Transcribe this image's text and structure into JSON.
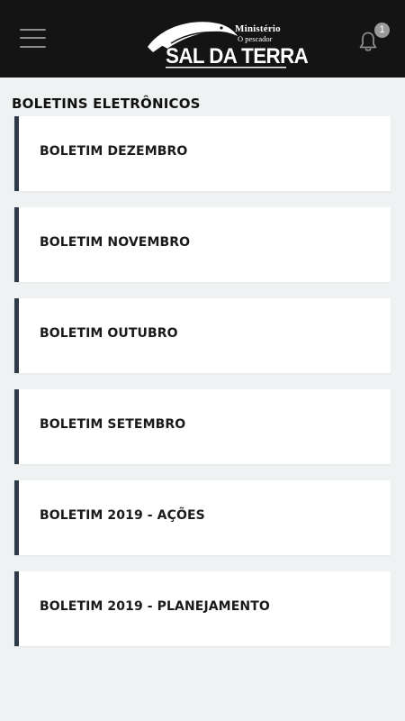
{
  "header": {
    "menu_icon": "hamburger-menu-icon",
    "logo": {
      "line1": "Ministério",
      "line2": "O pescador",
      "brand": "SAL DA TERRA"
    },
    "notifications": {
      "icon": "bell-icon",
      "count": "1"
    }
  },
  "section": {
    "title": "BOLETINS ELETRÔNICOS"
  },
  "bulletins": [
    {
      "label": "BOLETIM DEZEMBRO"
    },
    {
      "label": "BOLETIM NOVEMBRO"
    },
    {
      "label": "BOLETIM OUTUBRO"
    },
    {
      "label": "BOLETIM SETEMBRO"
    },
    {
      "label": "BOLETIM 2019 - AÇÕES"
    },
    {
      "label": "BOLETIM 2019 - PLANEJAMENTO"
    }
  ],
  "colors": {
    "topbar": "#141414",
    "background": "#eff2f3",
    "card_accent": "#2f3a48"
  }
}
